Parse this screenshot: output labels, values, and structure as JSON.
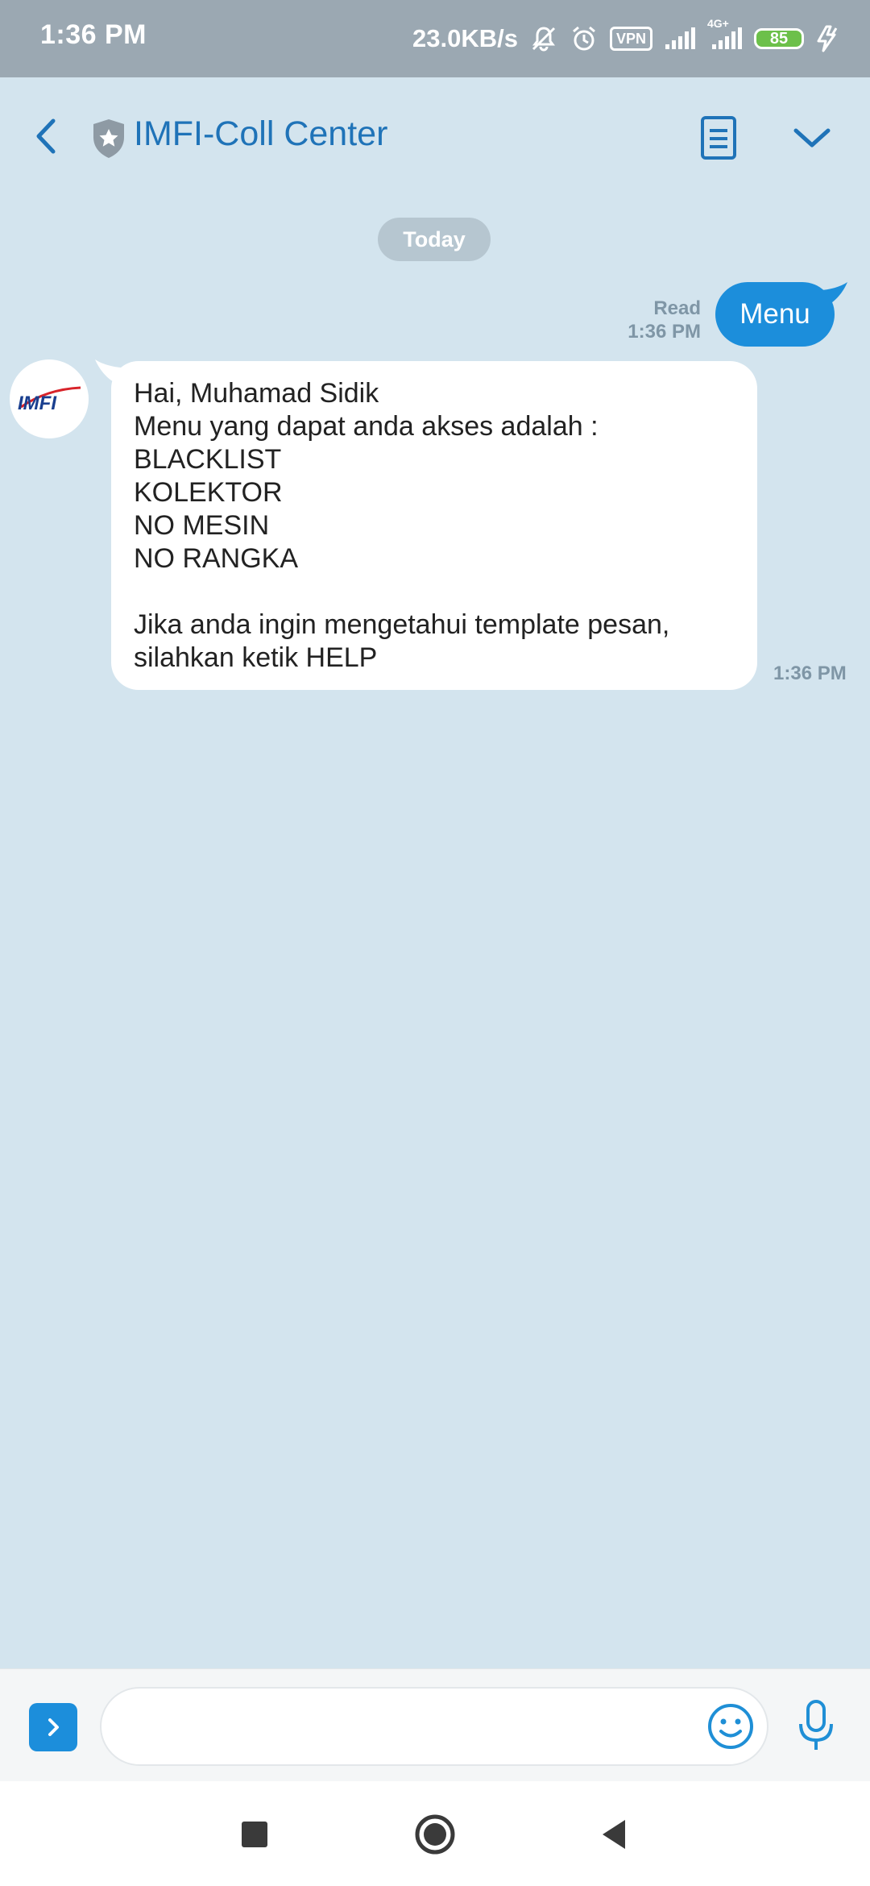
{
  "status_bar": {
    "time": "1:36 PM",
    "net_speed": "23.0KB/s",
    "vpn_label": "VPN",
    "network_type": "4G+",
    "battery_level": "85",
    "icons": [
      "mute-icon",
      "alarm-icon",
      "vpn-icon",
      "signal-icon",
      "signal-4g-icon",
      "battery-icon",
      "charging-icon"
    ],
    "color": "#9ba8b2"
  },
  "header": {
    "title": "IMFI-Coll Center",
    "icons": [
      "back-arrow-icon",
      "shield-star-icon",
      "notes-icon",
      "chevron-down-icon"
    ],
    "accent_color": "#1f73b8"
  },
  "chat": {
    "date_chip": "Today",
    "outgoing": {
      "text": "Menu",
      "status": "Read",
      "time": "1:36 PM",
      "bubble_color": "#1c8edb"
    },
    "incoming": {
      "avatar_text": "IMFI",
      "lines": [
        "Hai, Muhamad Sidik",
        "Menu yang dapat anda akses adalah :",
        "BLACKLIST",
        "KOLEKTOR",
        "NO MESIN",
        "NO RANGKA",
        "",
        "Jika anda ingin mengetahui template pesan,",
        "silahkan ketik HELP"
      ],
      "time": "1:36 PM"
    },
    "background_color": "#d3e4ee"
  },
  "input_bar": {
    "placeholder": "",
    "icons": [
      "expand-chevron-icon",
      "emoji-icon",
      "microphone-icon"
    ]
  },
  "nav_bar": {
    "icons": [
      "recents-square-icon",
      "home-circle-icon",
      "back-triangle-icon"
    ]
  }
}
